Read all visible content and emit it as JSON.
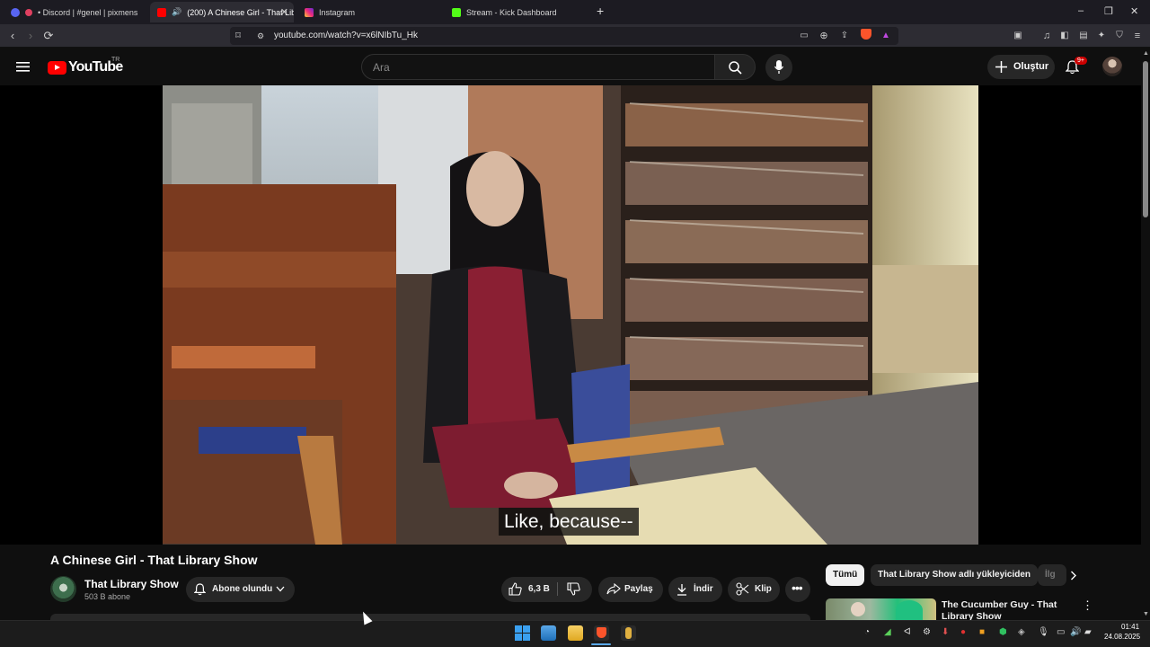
{
  "browser": {
    "tabs": [
      {
        "label": "• Discord | #genel | pixmens",
        "active": false
      },
      {
        "label": "(200) A Chinese Girl - That Lib",
        "active": true
      },
      {
        "label": "Instagram",
        "active": false
      },
      {
        "label": "Stream - Kick Dashboard",
        "active": false
      }
    ],
    "url": "youtube.com/watch?v=x6lNIbTu_Hk"
  },
  "youtube": {
    "logo_text": "YouTube",
    "country": "TR",
    "search_placeholder": "Ara",
    "create_label": "Oluştur",
    "notification_count": "9+"
  },
  "video": {
    "caption": "Like, because--",
    "title": "A Chinese Girl - That Library Show",
    "channel_name": "That Library Show",
    "subscribers": "503 B abone",
    "subscribe_label": "Abone olundu",
    "likes": "6,3 B",
    "share_label": "Paylaş",
    "download_label": "İndir",
    "clip_label": "Klip"
  },
  "chips": [
    "Tümü",
    "That Library Show adlı yükleyiciden",
    "İlg"
  ],
  "recommended": {
    "title": "The Cucumber Guy - That Library Show"
  },
  "taskbar": {
    "time": "01:41",
    "date": "24.08.2025"
  },
  "colors": {
    "youtube_red": "#ff0000",
    "background": "#0f0f0f",
    "kick_green": "#53fc18"
  }
}
